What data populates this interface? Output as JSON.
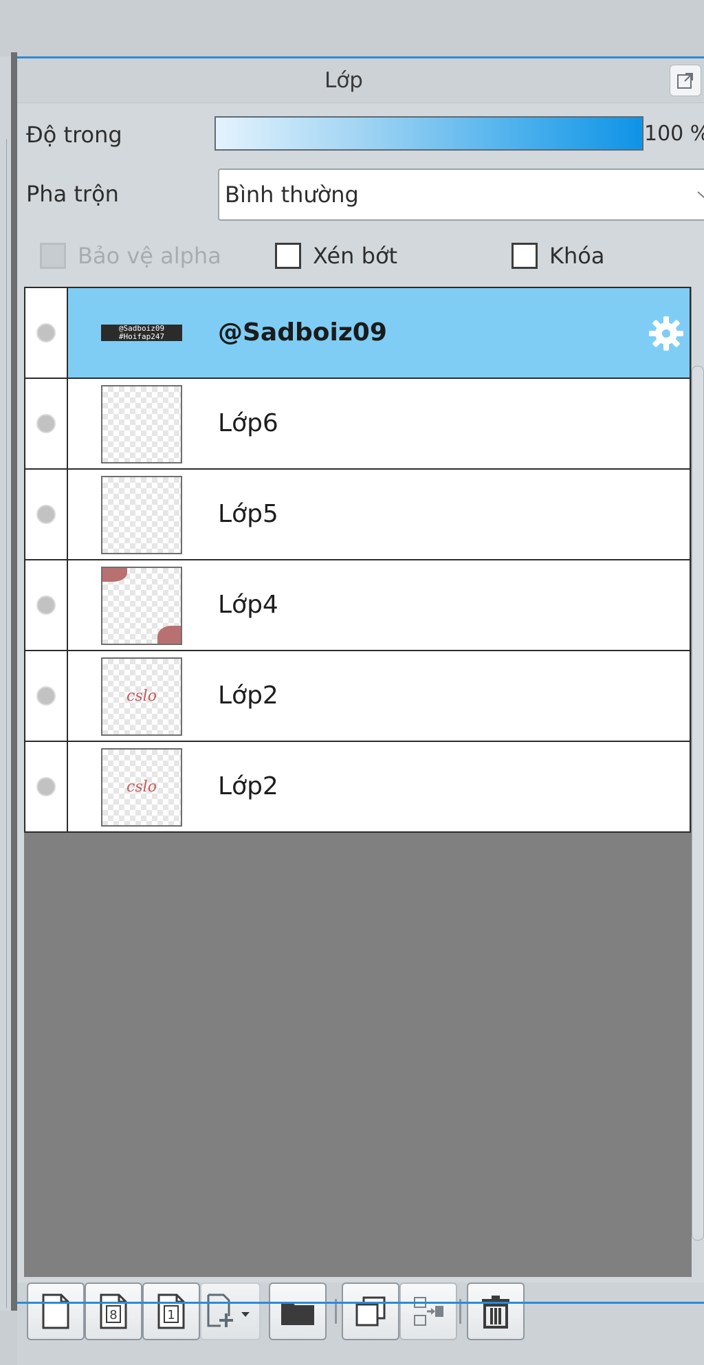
{
  "panel": {
    "title": "Lớp"
  },
  "opacity": {
    "label": "Độ trong",
    "value_text": "100 %",
    "fraction": 1.0
  },
  "blend": {
    "label": "Pha trộn",
    "value": "Bình thường"
  },
  "options": {
    "protect_alpha": {
      "label": "Bảo vệ alpha",
      "checked": false,
      "enabled": false
    },
    "clipping": {
      "label": "Xén bớt",
      "checked": false
    },
    "lock": {
      "label": "Khóa",
      "checked": false
    }
  },
  "layers": [
    {
      "name": "@Sadboiz09",
      "selected": true,
      "thumb": "text",
      "thumb_text": [
        "@Sadboiz09",
        "#Hoifap247"
      ]
    },
    {
      "name": "Lớp6",
      "selected": false,
      "thumb": "empty"
    },
    {
      "name": "Lớp5",
      "selected": false,
      "thumb": "empty"
    },
    {
      "name": "Lớp4",
      "selected": false,
      "thumb": "corners"
    },
    {
      "name": "Lớp2",
      "selected": false,
      "thumb": "script",
      "thumb_text": "cslo"
    },
    {
      "name": "Lớp2",
      "selected": false,
      "thumb": "script",
      "thumb_text": "cslo"
    }
  ],
  "toolbar": {
    "buttons": [
      "new-layer-icon",
      "new-8bit-layer-icon",
      "new-1bit-layer-icon",
      "add-layer-menu-icon",
      "new-folder-icon",
      "duplicate-layer-icon",
      "merge-down-icon",
      "delete-layer-icon"
    ],
    "badge_8": "8",
    "badge_1": "1"
  },
  "colors": {
    "selection": "#7fcdf4",
    "accent": "#2b8bd6",
    "opacity_fill": "#0f93e6"
  }
}
